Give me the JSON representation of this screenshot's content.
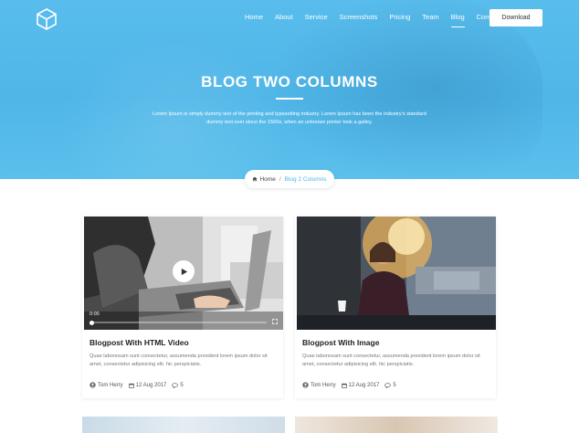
{
  "nav": {
    "items": [
      {
        "label": "Home",
        "active": false
      },
      {
        "label": "About",
        "active": false
      },
      {
        "label": "Service",
        "active": false
      },
      {
        "label": "Screenshots",
        "active": false
      },
      {
        "label": "Pricing",
        "active": false
      },
      {
        "label": "Team",
        "active": false
      },
      {
        "label": "Blog",
        "active": true
      },
      {
        "label": "Contact",
        "active": false
      }
    ],
    "download_label": "Download"
  },
  "hero": {
    "title": "BLOG TWO COLUMNS",
    "subtitle": "Lorem Ipsum is simply dummy text of the printing and typesetting industry. Lorem Ipsum has been the industry's standard dummy text ever since the 1500s, when an unknown printer took a galley."
  },
  "breadcrumb": {
    "home": "Home",
    "separator": "/",
    "current": "Blog 2 Columns"
  },
  "posts": [
    {
      "title": "Blogpost With HTML Video",
      "excerpt": "Quae labonosam sunt consectetur, assumenda provident lorem ipsum dolor sit amet, consectetur adipisicing elit. hic perspiciatis.",
      "author": "Tom Herry",
      "date": "12 Aug 2017",
      "comments": "5",
      "video_time": "0:00"
    },
    {
      "title": "Blogpost With Image",
      "excerpt": "Quae labonosam sunt consectetur, assumenda provident lorem ipsum dolor sit amet, consectetur adipisicing elit. hic perspiciatis.",
      "author": "Tom Herry",
      "date": "12 Aug 2017",
      "comments": "5"
    }
  ],
  "colors": {
    "accent": "#4fb6e8",
    "hero": "#58bdec"
  }
}
